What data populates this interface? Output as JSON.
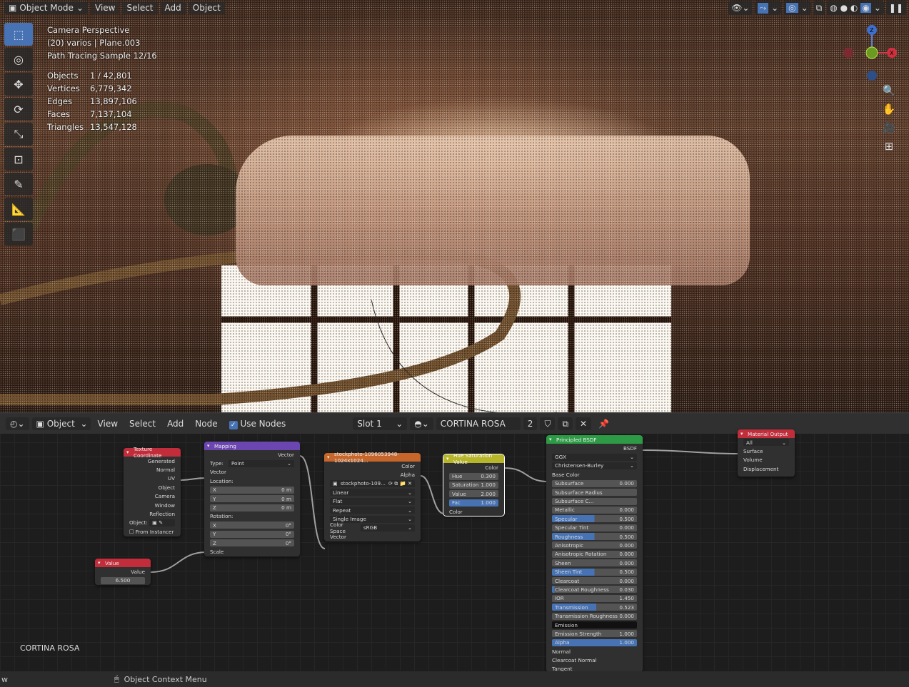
{
  "viewport": {
    "mode": "Object Mode",
    "menus": [
      "View",
      "Select",
      "Add",
      "Object"
    ],
    "overlay": {
      "line1": "Camera Perspective",
      "line2": "(20) varios | Plane.003",
      "line3": "Path Tracing Sample 12/16"
    },
    "stats": [
      {
        "k": "Objects",
        "v": "1 / 42,801"
      },
      {
        "k": "Vertices",
        "v": "6,779,342"
      },
      {
        "k": "Edges",
        "v": "13,897,106"
      },
      {
        "k": "Faces",
        "v": "7,137,104"
      },
      {
        "k": "Triangles",
        "v": "13,547,128"
      }
    ],
    "gizmo": {
      "z": "Z",
      "y": "Y",
      "x": "X"
    }
  },
  "node_editor": {
    "type": "Object",
    "menus": [
      "View",
      "Select",
      "Add",
      "Node"
    ],
    "use_nodes": "Use Nodes",
    "slot": "Slot 1",
    "material": "CORTINA ROSA",
    "users": "2",
    "label": "CORTINA ROSA"
  },
  "nodes": {
    "texcoord": {
      "title": "Texture Coordinate",
      "outputs": [
        "Generated",
        "Normal",
        "UV",
        "Object",
        "Camera",
        "Window",
        "Reflection"
      ],
      "object_label": "Object:",
      "from_instancer": "From Instancer"
    },
    "value": {
      "title": "Value",
      "output": "Value",
      "val": "6.500"
    },
    "mapping": {
      "title": "Mapping",
      "output": "Vector",
      "type_label": "Type:",
      "type": "Point",
      "vector": "Vector",
      "location": "Location:",
      "loc": [
        [
          "X",
          "0 m"
        ],
        [
          "Y",
          "0 m"
        ],
        [
          "Z",
          "0 m"
        ]
      ],
      "rotation": "Rotation:",
      "rot": [
        [
          "X",
          "0°"
        ],
        [
          "Y",
          "0°"
        ],
        [
          "Z",
          "0°"
        ]
      ],
      "scale": "Scale"
    },
    "image": {
      "title": "stockphoto-1096053948-1024x1024...",
      "out_color": "Color",
      "out_alpha": "Alpha",
      "file": "stockphoto-109...",
      "interp": "Linear",
      "proj": "Flat",
      "ext": "Repeat",
      "src": "Single Image",
      "cs_label": "Color Space",
      "cs": "sRGB",
      "vector": "Vector"
    },
    "hsv": {
      "title": "Hue Saturation Value",
      "out": "Color",
      "fields": [
        [
          "Hue",
          "0.300"
        ],
        [
          "Saturation",
          "1.000"
        ],
        [
          "Value",
          "2.000"
        ],
        [
          "Fac",
          "1.000"
        ]
      ],
      "color": "Color"
    },
    "bsdf": {
      "title": "Principled BSDF",
      "out": "BSDF",
      "dist": "GGX",
      "sss": "Christensen-Burley",
      "base_color": "Base Color",
      "fields": [
        [
          "Subsurface",
          "0.000",
          0
        ],
        [
          "Subsurface Radius",
          "",
          0
        ],
        [
          "Subsurface C...",
          "",
          0
        ],
        [
          "Metallic",
          "0.000",
          0
        ],
        [
          "Specular",
          "0.500",
          0.5
        ],
        [
          "Specular Tint",
          "0.000",
          0
        ],
        [
          "Roughness",
          "0.500",
          0.5
        ],
        [
          "Anisotropic",
          "0.000",
          0
        ],
        [
          "Anisotropic Rotation",
          "0.000",
          0
        ],
        [
          "Sheen",
          "0.000",
          0
        ],
        [
          "Sheen Tint",
          "0.500",
          0.5
        ],
        [
          "Clearcoat",
          "0.000",
          0
        ],
        [
          "Clearcoat Roughness",
          "0.030",
          0.03
        ],
        [
          "IOR",
          "1.450",
          0
        ],
        [
          "Transmission",
          "0.523",
          0.523
        ],
        [
          "Transmission Roughness",
          "0.000",
          0
        ],
        [
          "Emission",
          "",
          0
        ],
        [
          "Emission Strength",
          "1.000",
          0
        ],
        [
          "Alpha",
          "1.000",
          1
        ]
      ],
      "inputs": [
        "Normal",
        "Clearcoat Normal",
        "Tangent"
      ]
    },
    "output": {
      "title": "Material Output",
      "target": "All",
      "inputs": [
        "Surface",
        "Volume",
        "Displacement"
      ]
    }
  },
  "status": {
    "left": "w",
    "context": "Object Context Menu"
  }
}
